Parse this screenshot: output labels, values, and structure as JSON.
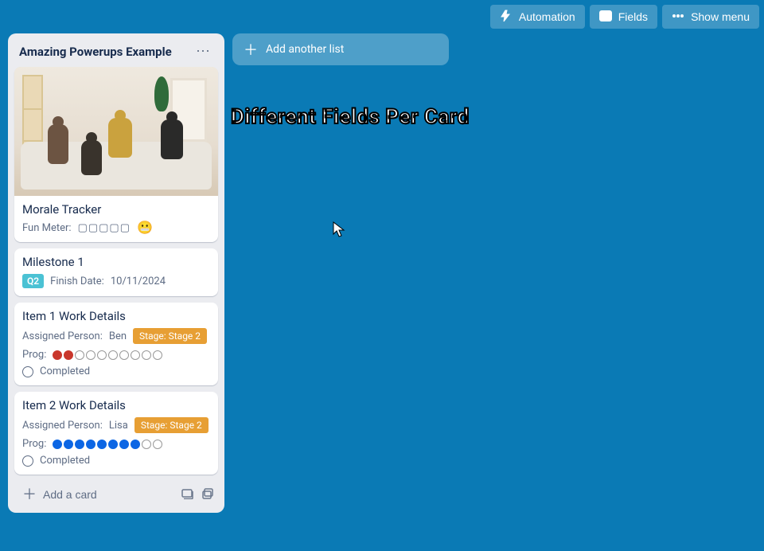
{
  "header": {
    "automation": "Automation",
    "fields": "Fields",
    "show_menu": "Show menu"
  },
  "overlay": {
    "title": "Different Fields Per Card"
  },
  "add_list_label": "Add another list",
  "list": {
    "title": "Amazing Powerups Example",
    "add_card": "Add a card",
    "cards": [
      {
        "title": "Morale Tracker",
        "fun_meter_label": "Fun Meter:",
        "fun_meter_boxes": "▢▢▢▢▢",
        "fun_meter_emoji": "😬"
      },
      {
        "title": "Milestone 1",
        "quarter": "Q2",
        "finish_date_label": "Finish Date:",
        "finish_date_value": "10/11/2024"
      },
      {
        "title": "Item 1 Work Details",
        "assigned_label": "Assigned Person:",
        "assigned_value": "Ben",
        "stage_label": "Stage: Stage 2",
        "prog_label": "Prog:",
        "prog_total": 10,
        "prog_filled": 2,
        "prog_color": "red",
        "completed_label": "Completed"
      },
      {
        "title": "Item 2 Work Details",
        "assigned_label": "Assigned Person:",
        "assigned_value": "Lisa",
        "stage_label": "Stage: Stage 2",
        "prog_label": "Prog:",
        "prog_total": 10,
        "prog_filled": 8,
        "prog_color": "blue",
        "completed_label": "Completed"
      }
    ]
  }
}
